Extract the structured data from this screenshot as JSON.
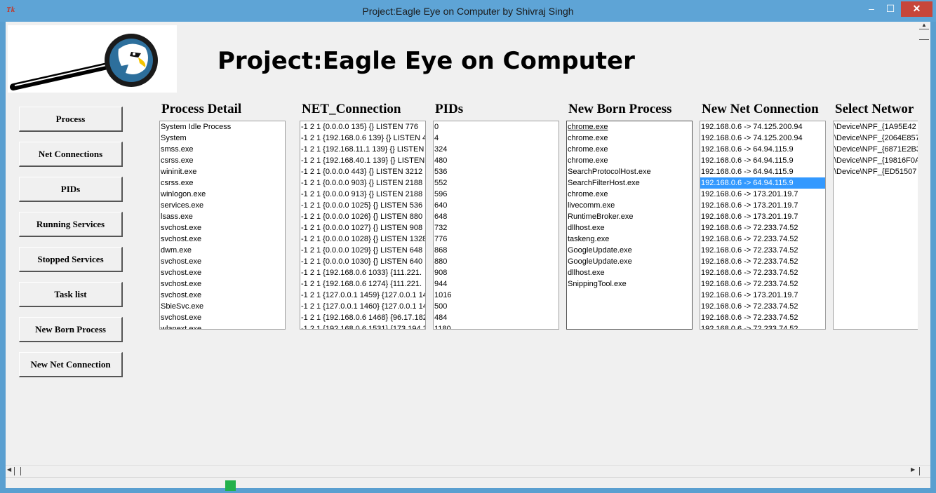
{
  "window": {
    "title": "Project:Eagle Eye on Computer by Shivraj Singh",
    "icon": "tk-feather-icon",
    "icon_text": "Tk",
    "controls": {
      "minimize": "–",
      "maximize": "☐",
      "close": "✕"
    }
  },
  "header": {
    "title": "Project:Eagle Eye on Computer"
  },
  "sidebar": {
    "buttons": [
      "Process",
      "Net Connections",
      "PIDs",
      "Running Services",
      "Stopped Services",
      "Task list",
      "New Born Process",
      "New Net Connection"
    ]
  },
  "columns": [
    {
      "heading": "Process Detail",
      "items": [
        "System Idle Process",
        "System",
        "smss.exe",
        "csrss.exe",
        "wininit.exe",
        "csrss.exe",
        "winlogon.exe",
        "services.exe",
        "lsass.exe",
        "svchost.exe",
        "svchost.exe",
        "dwm.exe",
        "svchost.exe",
        "svchost.exe",
        "svchost.exe",
        "svchost.exe",
        "SbieSvc.exe",
        "svchost.exe",
        "wlanext.exe"
      ]
    },
    {
      "heading": "NET_Connection",
      "items": [
        "-1 2 1 {0.0.0.0 135} {} LISTEN 776",
        "-1 2 1 {192.168.0.6 139} {} LISTEN 4",
        "-1 2 1 {192.168.11.1 139} {} LISTEN",
        "-1 2 1 {192.168.40.1 139} {} LISTEN",
        "-1 2 1 {0.0.0.0 443} {} LISTEN 3212",
        "-1 2 1 {0.0.0.0 903} {} LISTEN 2188",
        "-1 2 1 {0.0.0.0 913} {} LISTEN 2188",
        "-1 2 1 {0.0.0.0 1025} {} LISTEN 536",
        "-1 2 1 {0.0.0.0 1026} {} LISTEN 880",
        "-1 2 1 {0.0.0.0 1027} {} LISTEN 908",
        "-1 2 1 {0.0.0.0 1028} {} LISTEN 1328",
        "-1 2 1 {0.0.0.0 1029} {} LISTEN 648",
        "-1 2 1 {0.0.0.0 1030} {} LISTEN 640",
        "-1 2 1 {192.168.0.6 1033} {111.221.",
        "-1 2 1 {192.168.0.6 1274} {111.221.",
        "-1 2 1 {127.0.0.1 1459} {127.0.0.1 14",
        "-1 2 1 {127.0.0.1 1460} {127.0.0.1 14",
        "-1 2 1 {192.168.0.6 1468} {96.17.182",
        "-1 2 1 {192.168.0.6 1531} {173.194.3"
      ]
    },
    {
      "heading": "PIDs",
      "items": [
        "0",
        "4",
        "324",
        "480",
        "536",
        "552",
        "596",
        "640",
        "648",
        "732",
        "776",
        "868",
        "880",
        "908",
        "944",
        "1016",
        "500",
        "484",
        "1180"
      ]
    },
    {
      "heading": "New Born Process",
      "items": [
        "chrome.exe",
        "chrome.exe",
        "chrome.exe",
        "chrome.exe",
        "SearchProtocolHost.exe",
        "SearchFilterHost.exe",
        "chrome.exe",
        "livecomm.exe",
        "RuntimeBroker.exe",
        "dllhost.exe",
        "taskeng.exe",
        "GoogleUpdate.exe",
        "GoogleUpdate.exe",
        "dllhost.exe",
        "SnippingTool.exe"
      ]
    },
    {
      "heading": "New Net Connection",
      "items": [
        "192.168.0.6 -> 74.125.200.94",
        "192.168.0.6 -> 74.125.200.94",
        "192.168.0.6 -> 64.94.115.9",
        "192.168.0.6 -> 64.94.115.9",
        "192.168.0.6 -> 64.94.115.9",
        "192.168.0.6 -> 64.94.115.9",
        "192.168.0.6 -> 173.201.19.7",
        "192.168.0.6 -> 173.201.19.7",
        "192.168.0.6 -> 173.201.19.7",
        "192.168.0.6 -> 72.233.74.52",
        "192.168.0.6 -> 72.233.74.52",
        "192.168.0.6 -> 72.233.74.52",
        "192.168.0.6 -> 72.233.74.52",
        "192.168.0.6 -> 72.233.74.52",
        "192.168.0.6 -> 72.233.74.52",
        "192.168.0.6 -> 173.201.19.7",
        "192.168.0.6 -> 72.233.74.52",
        "192.168.0.6 -> 72.233.74.52",
        "192.168.0.6 -> 72.233.74.52"
      ],
      "selected_index": 5
    },
    {
      "heading": "Select Networ",
      "items": [
        "\\Device\\NPF_{1A95E42",
        "\\Device\\NPF_{2064E857",
        "\\Device\\NPF_{6871E2B3",
        "\\Device\\NPF_{19816F0A",
        "\\Device\\NPF_{ED51507"
      ]
    }
  ],
  "colors": {
    "titlebar": "#5ea4d6",
    "close": "#c7463a",
    "selection": "#3399ff",
    "indicator": "#22b14c"
  },
  "scrollbar_glyphs": {
    "left": "◀",
    "right": "▶",
    "up": "▲"
  }
}
